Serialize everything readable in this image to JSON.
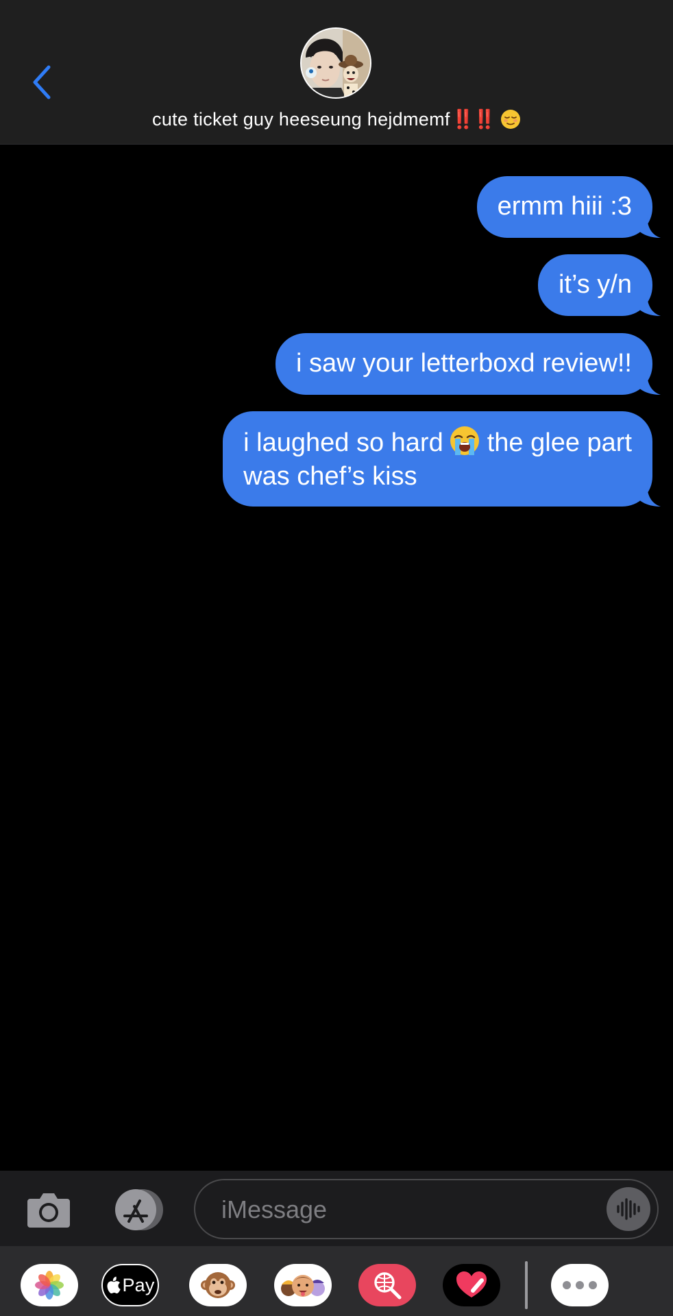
{
  "header": {
    "contact_name": "cute ticket guy heeseung hejdmemf",
    "emphasis_marks": "‼️‼️"
  },
  "messages": [
    {
      "text": "ermm hiii :3",
      "direction": "sent"
    },
    {
      "text": "it’s y/n",
      "direction": "sent"
    },
    {
      "text": "i saw your letterboxd review!!",
      "direction": "sent"
    },
    {
      "text_before_emoji": "i laughed so hard",
      "emoji": "loudly-crying-face",
      "text_after_emoji": "the glee part",
      "text_line2": "was chef’s kiss",
      "direction": "sent"
    }
  ],
  "input": {
    "placeholder": "iMessage",
    "value": ""
  },
  "drawer": {
    "apps": [
      {
        "name": "photos",
        "icon": "photos-icon"
      },
      {
        "name": "apple-pay",
        "label": "Pay",
        "icon": "apple-icon"
      },
      {
        "name": "animoji",
        "icon": "monkey-icon"
      },
      {
        "name": "memoji",
        "icon": "memoji-icon"
      },
      {
        "name": "images-search",
        "icon": "globe-search-icon"
      },
      {
        "name": "digital-touch",
        "icon": "heart-icon"
      },
      {
        "name": "more",
        "icon": "more-icon"
      }
    ]
  },
  "colors": {
    "accent_blue": "#3b7bea",
    "back_chevron": "#2f7cf6",
    "header_bg": "#1f1f1f",
    "emphasis_red": "#e0312e"
  }
}
